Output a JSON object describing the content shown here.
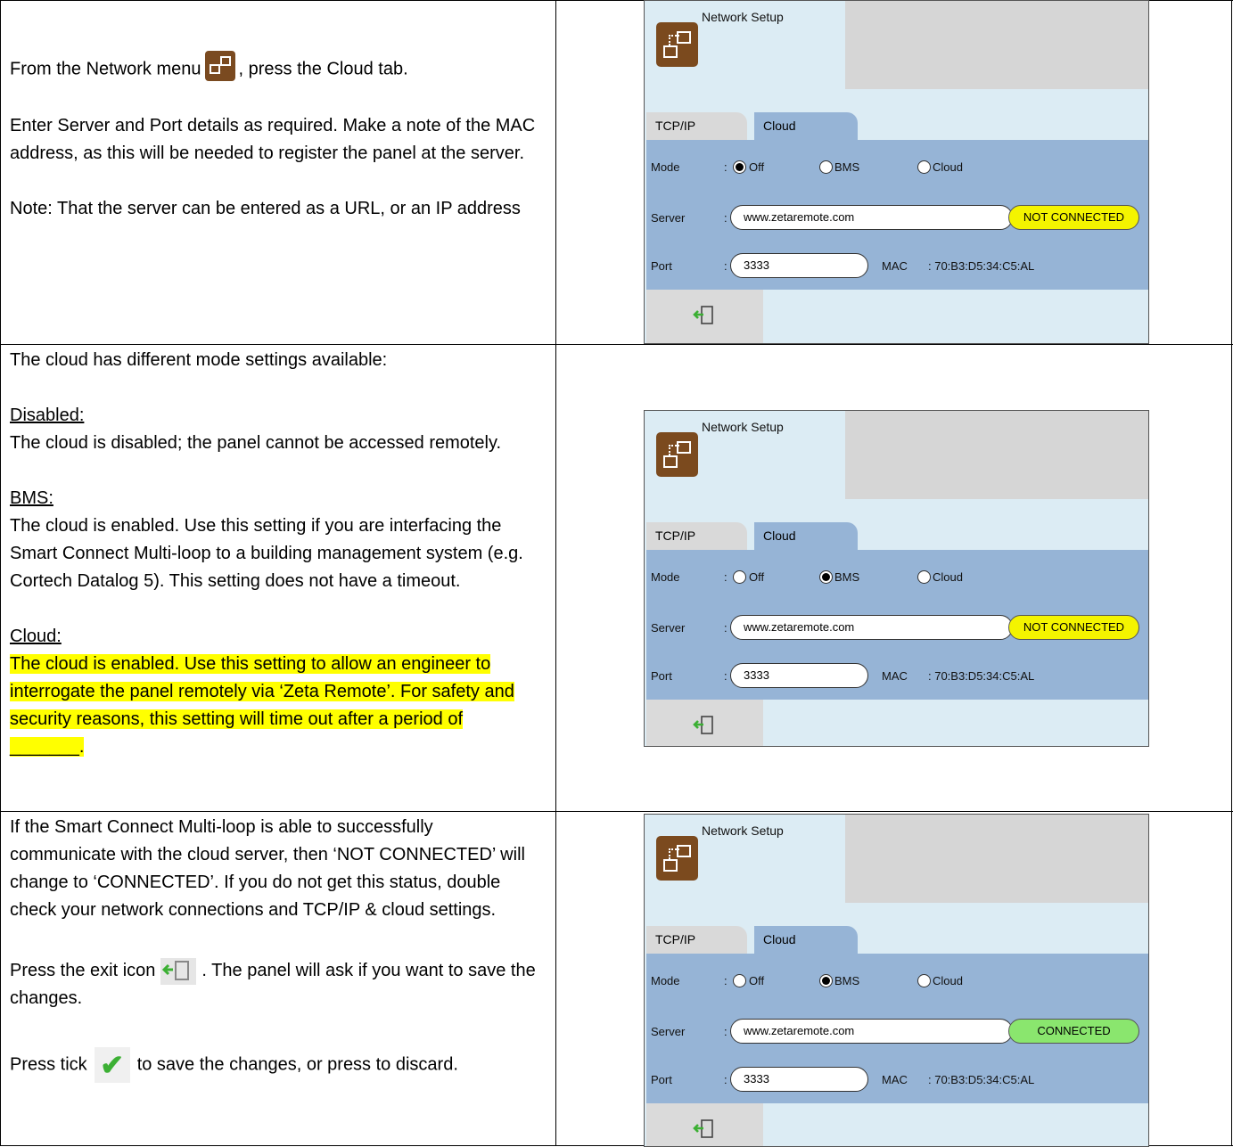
{
  "rows": [
    {
      "paragraphs": {
        "p1_before": "From the Network menu",
        "p1_after": ", press the Cloud tab.",
        "p2": "Enter Server and Port details as required. Make a note of the MAC address, as this will be needed to register the panel at the server.",
        "p3": "Note: That the server can be entered as a URL, or an IP address"
      }
    },
    {
      "intro": "The cloud has different mode settings available:",
      "disabled_title": "Disabled:",
      "disabled_text": "The cloud is disabled; the panel cannot be accessed remotely.",
      "bms_title": "BMS:",
      "bms_text": "The cloud is enabled. Use this setting if you are interfacing the Smart Connect Multi-loop to a building management system (e.g. Cortech Datalog 5). This setting does not have a timeout.",
      "cloud_title": "Cloud:",
      "cloud_text": "The cloud is enabled. Use this setting to allow an engineer to interrogate the panel remotely via ‘Zeta Remote’.  For safety and security reasons, this setting will time out after a period of _______."
    },
    {
      "p1": "If the Smart Connect Multi-loop is able to successfully communicate with the cloud server, then ‘NOT CONNECTED’ will change to ‘CONNECTED’. If you do not get this status, double check your network connections and TCP/IP & cloud settings.",
      "p2_before": "Press the exit icon",
      "p2_after": ". The panel will ask if you want to save the changes.",
      "p3_before": "Press tick",
      "p3_after": "to save the changes, or press   to discard."
    }
  ],
  "panels": [
    {
      "title": "Network Setup",
      "tab_tcp": "TCP/IP",
      "tab_cloud": "Cloud",
      "mode_label": "Mode",
      "colon": ":",
      "opt_off": "Off",
      "opt_bms": "BMS",
      "opt_cloud": "Cloud",
      "selected": "Off",
      "server_label": "Server",
      "server_value": "www.zetaremote.com",
      "status": "NOT CONNECTED",
      "port_label": "Port",
      "port_value": "3333",
      "mac_label": "MAC",
      "mac_value": ": 70:B3:D5:34:C5:AL",
      "status_color": "#f4f400"
    },
    {
      "title": "Network Setup",
      "tab_tcp": "TCP/IP",
      "tab_cloud": "Cloud",
      "mode_label": "Mode",
      "colon": ":",
      "opt_off": "Off",
      "opt_bms": "BMS",
      "opt_cloud": "Cloud",
      "selected": "BMS",
      "server_label": "Server",
      "server_value": "www.zetaremote.com",
      "status": "NOT CONNECTED",
      "port_label": "Port",
      "port_value": "3333",
      "mac_label": "MAC",
      "mac_value": ": 70:B3:D5:34:C5:AL",
      "status_color": "#f4f400"
    },
    {
      "title": "Network Setup",
      "tab_tcp": "TCP/IP",
      "tab_cloud": "Cloud",
      "mode_label": "Mode",
      "colon": ":",
      "opt_off": "Off",
      "opt_bms": "BMS",
      "opt_cloud": "Cloud",
      "selected": "BMS",
      "server_label": "Server",
      "server_value": "www.zetaremote.com",
      "status": "CONNECTED",
      "port_label": "Port",
      "port_value": "3333",
      "mac_label": "MAC",
      "mac_value": ": 70:B3:D5:34:C5:AL",
      "status_color": "#8ae66e"
    }
  ],
  "icons": {
    "network": "network-menu-icon",
    "exit": "exit-icon",
    "tick": "tick-icon"
  }
}
